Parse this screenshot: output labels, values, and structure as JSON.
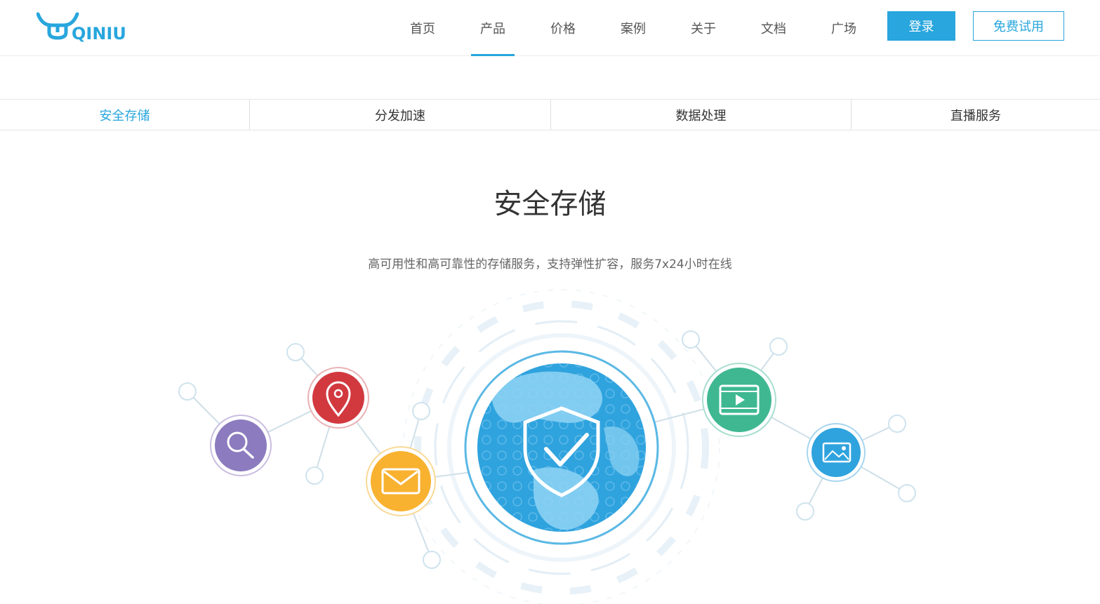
{
  "header": {
    "logo_text": "QINIU",
    "nav": [
      {
        "label": "首页"
      },
      {
        "label": "产品",
        "active": true
      },
      {
        "label": "价格"
      },
      {
        "label": "案例"
      },
      {
        "label": "关于"
      },
      {
        "label": "文档"
      },
      {
        "label": "广场"
      }
    ],
    "login_label": "登录",
    "trial_label": "免费试用"
  },
  "subtabs": [
    {
      "label": "安全存储",
      "active": true
    },
    {
      "label": "分发加速"
    },
    {
      "label": "数据处理"
    },
    {
      "label": "直播服务"
    }
  ],
  "main": {
    "title": "安全存储",
    "subtitle": "高可用性和高可靠性的存储服务，支持弹性扩容，服务7x24小时在线"
  },
  "colors": {
    "brand": "#28a6dd",
    "purple": "#8c7bbf",
    "red": "#d2393f",
    "orange": "#f8b230",
    "green": "#3fb891",
    "blue": "#2fa3de"
  },
  "icons": [
    "search-icon",
    "location-pin-icon",
    "mail-icon",
    "shield-check-icon",
    "video-icon",
    "image-icon"
  ]
}
